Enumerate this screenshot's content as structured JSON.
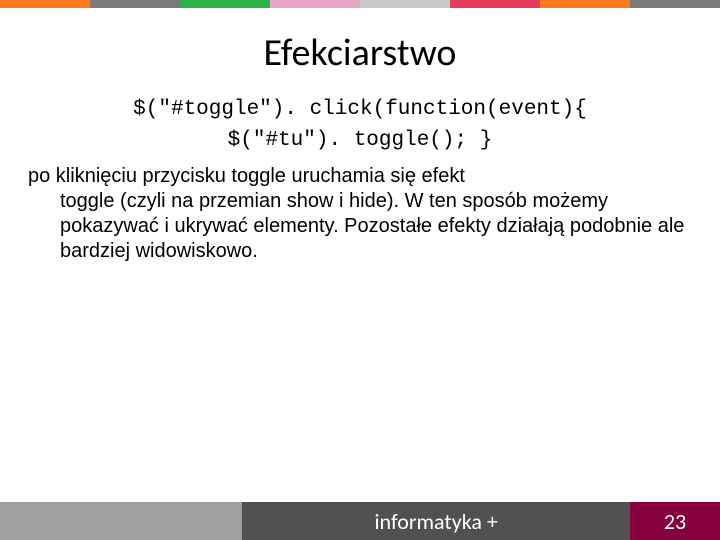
{
  "stripe_colors": [
    "#ff7a1a",
    "#7a7a7a",
    "#2bb24a",
    "#e6a6c4",
    "#c9c9c9",
    "#e63c5a",
    "#ff7a1a",
    "#7a7a7a"
  ],
  "title": "Efekciarstwo",
  "code": {
    "line1": "$(\"#toggle\"). click(function(event){",
    "line2": "$(\"#tu\"). toggle(); }"
  },
  "body": {
    "first": "po kliknięciu przycisku toggle uruchamia się efekt",
    "rest": "toggle (czyli na przemian show i hide). W ten sposób możemy pokazywać i ukrywać elementy. Pozostałe efekty działają podobnie ale bardziej widowiskowo."
  },
  "footer": {
    "brand": "informatyka +",
    "page": "23"
  }
}
